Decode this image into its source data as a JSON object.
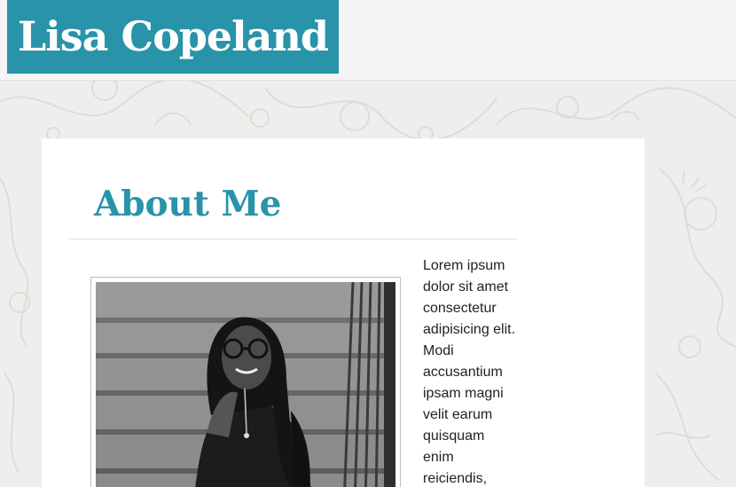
{
  "site": {
    "logo_text": "Lisa Copeland",
    "brand_color": "#2893a9"
  },
  "main": {
    "page_title": "About Me",
    "photo_alt": "Portrait of Lisa Copeland sitting on stairs",
    "bio_text": "Lorem ipsum dolor sit amet consectetur adipisicing elit. Modi accusantium ipsam magni velit earum quisquam enim reiciendis,"
  }
}
